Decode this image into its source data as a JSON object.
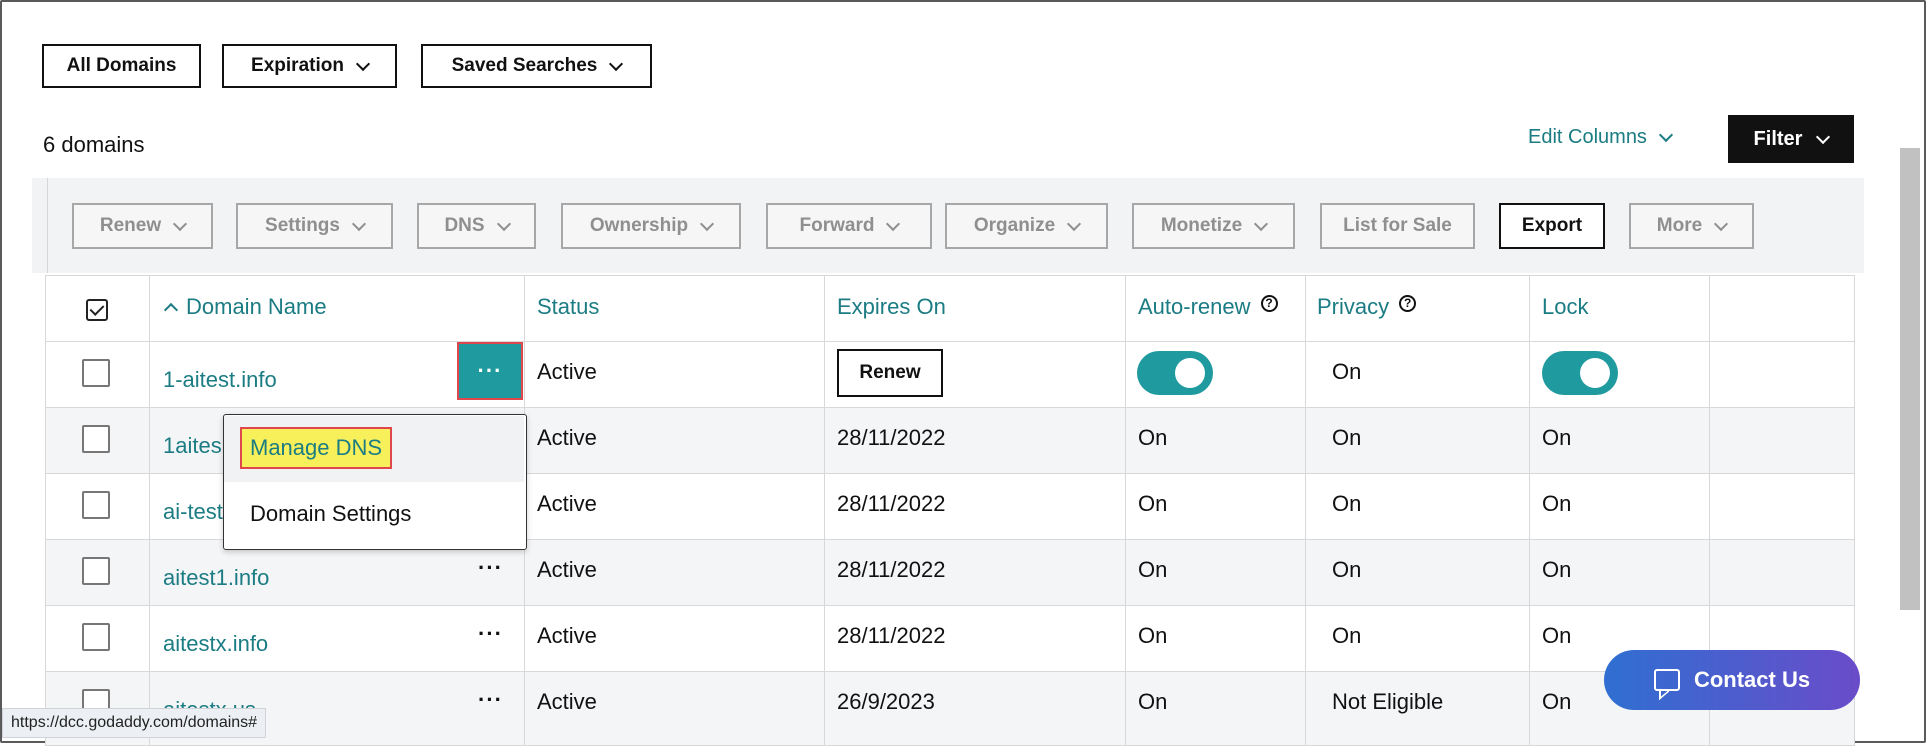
{
  "top_bar": {
    "all_domains": "All Domains",
    "expiration": "Expiration",
    "saved_searches": "Saved Searches"
  },
  "summary": {
    "count": "6 domains",
    "edit_columns": "Edit Columns",
    "filter": "Filter"
  },
  "toolbar": {
    "renew": "Renew",
    "settings": "Settings",
    "dns": "DNS",
    "ownership": "Ownership",
    "forward": "Forward",
    "organize": "Organize",
    "monetize": "Monetize",
    "list_for_sale": "List for Sale",
    "export": "Export",
    "more": "More"
  },
  "table": {
    "headers": {
      "domain_name": "Domain Name",
      "status": "Status",
      "expires_on": "Expires On",
      "auto_renew": "Auto-renew",
      "privacy": "Privacy",
      "lock": "Lock"
    },
    "help_glyph": "?",
    "more_glyph": "···",
    "rows": [
      {
        "domain": "1-aitest.info",
        "status": "Active",
        "expires": "",
        "renew_label": "Renew",
        "auto_renew": "on",
        "privacy": "On",
        "lock": "on"
      },
      {
        "domain": "1aites",
        "status": "Active",
        "expires": "28/11/2022",
        "auto_renew": "On",
        "privacy": "On",
        "lock": "On"
      },
      {
        "domain": "ai-test",
        "status": "Active",
        "expires": "28/11/2022",
        "auto_renew": "On",
        "privacy": "On",
        "lock": "On"
      },
      {
        "domain": "aitest1.info",
        "status": "Active",
        "expires": "28/11/2022",
        "auto_renew": "On",
        "privacy": "On",
        "lock": "On"
      },
      {
        "domain": "aitestx.info",
        "status": "Active",
        "expires": "28/11/2022",
        "auto_renew": "On",
        "privacy": "On",
        "lock": "On"
      },
      {
        "domain": "aitestx.us",
        "status": "Active",
        "expires": "26/9/2023",
        "auto_renew": "On",
        "privacy": "Not Eligible",
        "lock": "On"
      }
    ]
  },
  "context_menu": {
    "manage_dns": "Manage DNS",
    "domain_settings": "Domain Settings"
  },
  "contact_us": "Contact Us",
  "status_bar_url": "https://dcc.godaddy.com/domains#",
  "colors": {
    "accent": "#1b7c83",
    "toggle": "#1f9a9e",
    "highlight": "#f8f05a",
    "highlight_border": "#e0474c"
  }
}
